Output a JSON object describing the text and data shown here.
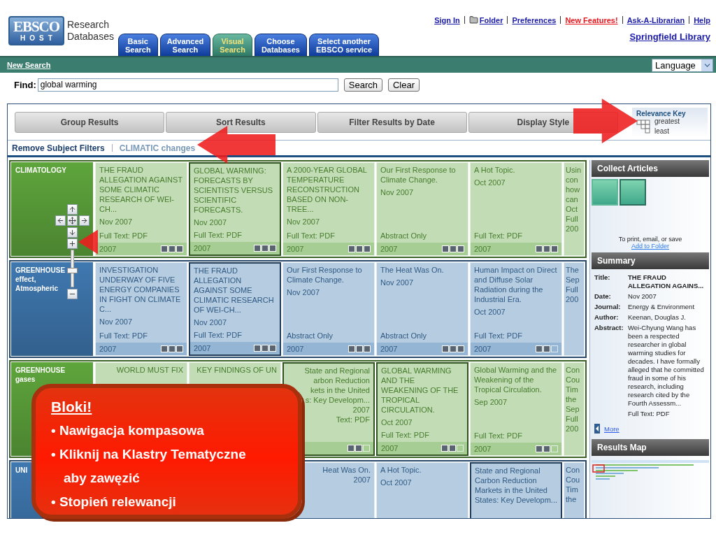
{
  "logo": {
    "top": "EBSCO",
    "bottom": "HOST",
    "line_1": "Research",
    "line_2": "Databases"
  },
  "tabs": [
    {
      "label": "Basic\nSearch",
      "selected": false
    },
    {
      "label": "Advanced\nSearch",
      "selected": false
    },
    {
      "label": "Visual\nSearch",
      "selected": true
    },
    {
      "label": "Choose\nDatabases",
      "selected": false
    },
    {
      "label": "Select another\nEBSCO service",
      "selected": false
    }
  ],
  "top_links": [
    {
      "label": "Sign In",
      "kind": "text",
      "color": "#1a1aa8"
    },
    {
      "label": "Folder",
      "kind": "folder",
      "color": "#1a1aa8"
    },
    {
      "label": "Preferences",
      "kind": "text",
      "color": "#1a1aa8"
    },
    {
      "label": "New Features!",
      "kind": "text",
      "color": "#e8141c"
    },
    {
      "label": "Ask-A-Librarian",
      "kind": "text",
      "color": "#1a1aa8"
    },
    {
      "label": "Help",
      "kind": "text",
      "color": "#1a1aa8"
    }
  ],
  "library": "Springfield Library",
  "nav_bar": {
    "link": "New Search",
    "language": "Language"
  },
  "find": {
    "label": "Find:",
    "value": "global warming",
    "buttons": [
      "Search",
      "Clear"
    ]
  },
  "toolbar": {
    "buttons": [
      "Group Results",
      "Sort Results",
      "Filter Results by Date",
      "Display Style"
    ],
    "relevance_key": {
      "title": "Relevance Key",
      "high": "greatest",
      "low": "least"
    }
  },
  "filters": {
    "remove": "Remove Subject Filters",
    "active": "CLIMATIC changes"
  },
  "clusters": [
    {
      "label": "CLIMATOLOGY",
      "color": "#5ea53c",
      "cards": [
        {
          "kind": "article",
          "title": "THE FRAUD ALLEGATION AGAINST SOME CLIMATIC RESEARCH OF WEI-CH...",
          "date": "Nov 2007",
          "type": "Full Text: PDF",
          "year": "2007",
          "stars": 3,
          "selected": false
        },
        {
          "kind": "article",
          "title": "GLOBAL WARMING: FORECASTS BY SCIENTISTS VERSUS SCIENTIFIC FORECASTS.",
          "date": "Nov 2007",
          "type": "Full Text: PDF",
          "year": "2007",
          "stars": 3,
          "selected": true
        },
        {
          "kind": "article",
          "title": "A 2000-YEAR GLOBAL TEMPERATURE RECONSTRUCTION BASED ON NON-TREE...",
          "date": "Nov 2007",
          "type": "Full Text: PDF",
          "year": "2007",
          "stars": 3,
          "selected": false
        },
        {
          "kind": "article",
          "title": "Our First Response to Climate Change.",
          "date": "Nov 2007",
          "type": "Abstract Only",
          "year": "2007",
          "stars": 3,
          "selected": false
        },
        {
          "kind": "article",
          "title": "A Hot Topic.",
          "date": "Oct 2007",
          "type": "Full Text: PDF",
          "year": "2007",
          "stars": 3,
          "selected": false
        },
        {
          "kind": "edge",
          "lines": [
            "Usin",
            "con",
            "how",
            "can",
            "Oct",
            "Full",
            "200"
          ]
        }
      ]
    },
    {
      "label": "GREENHOUSE effect, Atmospheric",
      "color": "#3f78b0",
      "cards": [
        {
          "kind": "article",
          "title": "INVESTIGATION UNDERWAY OF FIVE ENERGY COMPANIES IN FIGHT ON CLIMATE C...",
          "date": "Nov 2007",
          "type": "Full Text: PDF",
          "year": "2007",
          "stars": 3,
          "selected": false
        },
        {
          "kind": "article",
          "title": "THE FRAUD ALLEGATION AGAINST SOME CLIMATIC RESEARCH OF WEI-CH...",
          "date": "Nov 2007",
          "type": "Full Text: PDF",
          "year": "2007",
          "stars": 3,
          "selected": true
        },
        {
          "kind": "article",
          "title": "Our First Response to Climate Change.",
          "date": "Nov 2007",
          "type": "Abstract Only",
          "year": "2007",
          "stars": 3,
          "selected": false
        },
        {
          "kind": "article",
          "title": "The Heat Was On.",
          "date": "Nov 2007",
          "type": "Abstract Only",
          "year": "2007",
          "stars": 3,
          "selected": false
        },
        {
          "kind": "article",
          "title": "Human Impact on Direct and Diffuse Solar Radiation during the Industrial Era.",
          "date": "Oct 2007",
          "type": "Full Text: PDF",
          "year": "2007",
          "stars": 2,
          "selected": false
        },
        {
          "kind": "edge",
          "lines": [
            "The",
            "Sep",
            "Full",
            "200"
          ]
        }
      ]
    },
    {
      "label": "GREENHOUSE gases",
      "color": "#5ea53c",
      "cards": [
        {
          "kind": "covered",
          "lines": [
            "WORLD MUST FIX"
          ]
        },
        {
          "kind": "covered",
          "lines": [
            "KEY FINDINGS OF UN"
          ]
        },
        {
          "kind": "covered",
          "lines": [
            "State and Regional",
            "arbon Reduction",
            "kets in the United",
            "s: Key Developm...",
            "2007",
            "Text: PDF"
          ],
          "stars": 2,
          "selected": true
        },
        {
          "kind": "article",
          "title": "GLOBAL WARMING AND THE WEAKENING OF THE TROPICAL CIRCULATION.",
          "date": "Oct 2007",
          "type": "Full Text: PDF",
          "year": "2007",
          "stars": 2,
          "selected": true
        },
        {
          "kind": "article",
          "title": "Global Warming and the Weakening of the Tropical Circulation.",
          "date": "Sep 2007",
          "type": "Full Text: PDF",
          "year": "2007",
          "stars": 2,
          "selected": false
        },
        {
          "kind": "edge",
          "lines": [
            "Con",
            "Cou",
            "Tim",
            "the",
            "Sep",
            "Full",
            "200"
          ]
        }
      ]
    },
    {
      "label": "UNI",
      "color": "#3f78b0",
      "cards": [
        {
          "kind": "covered",
          "lines": [
            "Heat Was On.",
            "2007"
          ]
        },
        {
          "kind": "article",
          "title": "A Hot Topic.",
          "date": "Oct 2007",
          "selected": false
        },
        {
          "kind": "article",
          "title": "State and Regional Carbon Reduction Markets in the United States: Key Developm...",
          "selected": true
        },
        {
          "kind": "edge",
          "lines": [
            "Con",
            "Cou",
            "Tim",
            "the"
          ]
        }
      ]
    }
  ],
  "collect": {
    "title": "Collect Articles",
    "note": "To print, email, or save",
    "link": "Add to Folder"
  },
  "summary": {
    "title": "Summary",
    "fields": [
      {
        "label": "Title:",
        "value": "THE FRAUD ALLEGATION AGAINS...",
        "kind": "title"
      },
      {
        "label": "Date:",
        "value": "Nov 2007",
        "kind": "text"
      },
      {
        "label": "Journal:",
        "value": "Energy & Environment",
        "kind": "text"
      },
      {
        "label": "Author:",
        "value": "Keenan, Douglas J.",
        "kind": "text"
      },
      {
        "label": "Abstract:",
        "value": "Wei-Chyung Wang has been a respected researcher in global warming studies for decades. I have formally alleged that he committed fraud in some of his research, including research cited by the Fourth Assessm...",
        "kind": "text"
      }
    ],
    "extra": "Full Text: PDF",
    "more": "More"
  },
  "results_map": {
    "title": "Results Map"
  },
  "callout": {
    "title": "Bloki!",
    "lines": [
      "• Nawigacja kompasowa",
      "• Kliknij na Klastry Tematyczne",
      "aby zawęzić",
      "• Stopień relewancji"
    ]
  }
}
